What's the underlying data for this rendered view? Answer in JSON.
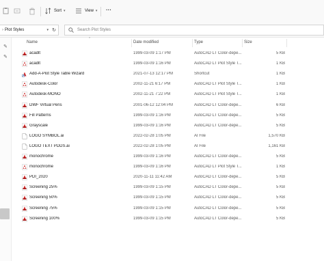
{
  "toolbar": {
    "sort_label": "Sort",
    "view_label": "View",
    "more_label": "···"
  },
  "address": {
    "crumb": "Plot Styles",
    "search_placeholder": "Search Plot Styles"
  },
  "columns": {
    "name": "Name",
    "date": "Date modified",
    "type": "Type",
    "size": "Size"
  },
  "files": [
    {
      "name": "acadlt",
      "date": "1999-03-09 1:17 PM",
      "type": "AutoCAD LT Color-depe...",
      "size": "5 KB",
      "icon": "ctb-icon"
    },
    {
      "name": "acadlt",
      "date": "1999-03-09 1:16 PM",
      "type": "AutoCAD LT Plot Style T...",
      "size": "1 KB",
      "icon": "stb-icon"
    },
    {
      "name": "Add-A-Plot Style Table Wizard",
      "date": "2021-07-13 12:17 PM",
      "type": "Shortcut",
      "size": "1 KB",
      "icon": "shortcut-icon"
    },
    {
      "name": "Autodesk-Color",
      "date": "2002-11-21 6:17 PM",
      "type": "AutoCAD LT Plot Style T...",
      "size": "1 KB",
      "icon": "stb-icon"
    },
    {
      "name": "Autodesk-MONO",
      "date": "2002-11-21 7:22 PM",
      "type": "AutoCAD LT Plot Style T...",
      "size": "1 KB",
      "icon": "stb-icon"
    },
    {
      "name": "DWF Virtual Pens",
      "date": "2001-06-12 12:04 PM",
      "type": "AutoCAD LT Color-depe...",
      "size": "6 KB",
      "icon": "ctb-icon"
    },
    {
      "name": "Fill Patterns",
      "date": "1999-03-09 1:16 PM",
      "type": "AutoCAD LT Color-depe...",
      "size": "5 KB",
      "icon": "ctb-icon"
    },
    {
      "name": "Grayscale",
      "date": "1999-03-09 1:16 PM",
      "type": "AutoCAD LT Color-depe...",
      "size": "5 KB",
      "icon": "ctb-icon"
    },
    {
      "name": "LOGO SYMBOL.ai",
      "date": "2022-02-28 1:05 PM",
      "type": "AI File",
      "size": "1,570 KB",
      "icon": "ai-file-icon"
    },
    {
      "name": "LOGO TEXT PDDS.ai",
      "date": "2022-02-28 1:05 PM",
      "type": "AI File",
      "size": "1,161 KB",
      "icon": "ai-file-icon"
    },
    {
      "name": "monochrome",
      "date": "1999-03-09 1:16 PM",
      "type": "AutoCAD LT Color-depe...",
      "size": "5 KB",
      "icon": "ctb-icon"
    },
    {
      "name": "monochrome",
      "date": "1999-03-09 1:16 PM",
      "type": "AutoCAD LT Plot Style T...",
      "size": "1 KB",
      "icon": "stb-icon"
    },
    {
      "name": "PDI_2020",
      "date": "2020-11-11 11:42 AM",
      "type": "AutoCAD LT Color-depe...",
      "size": "5 KB",
      "icon": "ctb-icon"
    },
    {
      "name": "Screening 25%",
      "date": "1999-03-09 1:15 PM",
      "type": "AutoCAD LT Color-depe...",
      "size": "5 KB",
      "icon": "ctb-icon"
    },
    {
      "name": "Screening 50%",
      "date": "1999-03-09 1:15 PM",
      "type": "AutoCAD LT Color-depe...",
      "size": "5 KB",
      "icon": "ctb-icon"
    },
    {
      "name": "Screening 75%",
      "date": "1999-03-09 1:15 PM",
      "type": "AutoCAD LT Color-depe...",
      "size": "5 KB",
      "icon": "ctb-icon"
    },
    {
      "name": "Screening 100%",
      "date": "1999-03-09 1:15 PM",
      "type": "AutoCAD LT Color-depe...",
      "size": "5 KB",
      "icon": "ctb-icon"
    }
  ]
}
